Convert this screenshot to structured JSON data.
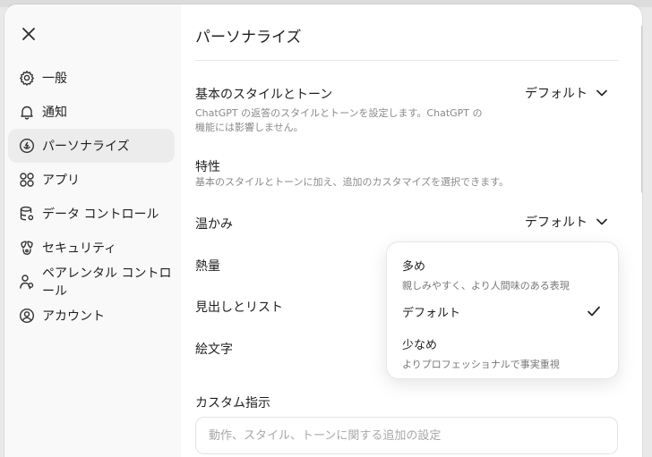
{
  "sidebar": {
    "items": [
      {
        "label": "一般",
        "icon": "gear-icon"
      },
      {
        "label": "通知",
        "icon": "bell-icon"
      },
      {
        "label": "パーソナライズ",
        "icon": "personalize-icon",
        "active": true
      },
      {
        "label": "アプリ",
        "icon": "apps-grid-icon"
      },
      {
        "label": "データ コントロール",
        "icon": "database-gear-icon"
      },
      {
        "label": "セキュリティ",
        "icon": "shield-lock-icon"
      },
      {
        "label": "ペアレンタル コントロール",
        "icon": "parent-user-icon"
      },
      {
        "label": "アカウント",
        "icon": "account-circle-icon"
      }
    ]
  },
  "main": {
    "title": "パーソナライズ",
    "base_style": {
      "label": "基本のスタイルとトーン",
      "desc": "ChatGPT の返答のスタイルとトーンを設定します。ChatGPT の機能には影響しません。",
      "value": "デフォルト"
    },
    "traits": {
      "label": "特性",
      "desc": "基本のスタイルとトーンに加え、追加のカスタマイズを選択できます。"
    },
    "warmth": {
      "label": "温かみ",
      "value": "デフォルト"
    },
    "enthusiasm": {
      "label": "熱量"
    },
    "headers_lists": {
      "label": "見出しとリスト"
    },
    "emoji": {
      "label": "絵文字"
    },
    "custom_instructions": {
      "label": "カスタム指示",
      "placeholder": "動作、スタイル、トーンに関する追加の設定"
    }
  },
  "dropdown": {
    "options": [
      {
        "title": "多め",
        "desc": "親しみやすく、より人間味のある表現"
      },
      {
        "title": "デフォルト",
        "desc": "",
        "selected": true
      },
      {
        "title": "少なめ",
        "desc": "よりプロフェッショナルで事実重視"
      }
    ]
  },
  "colors": {
    "accent_bg": "#ececec",
    "sidebar_bg": "#f9f9f9",
    "muted_text": "#8a8a8a"
  }
}
